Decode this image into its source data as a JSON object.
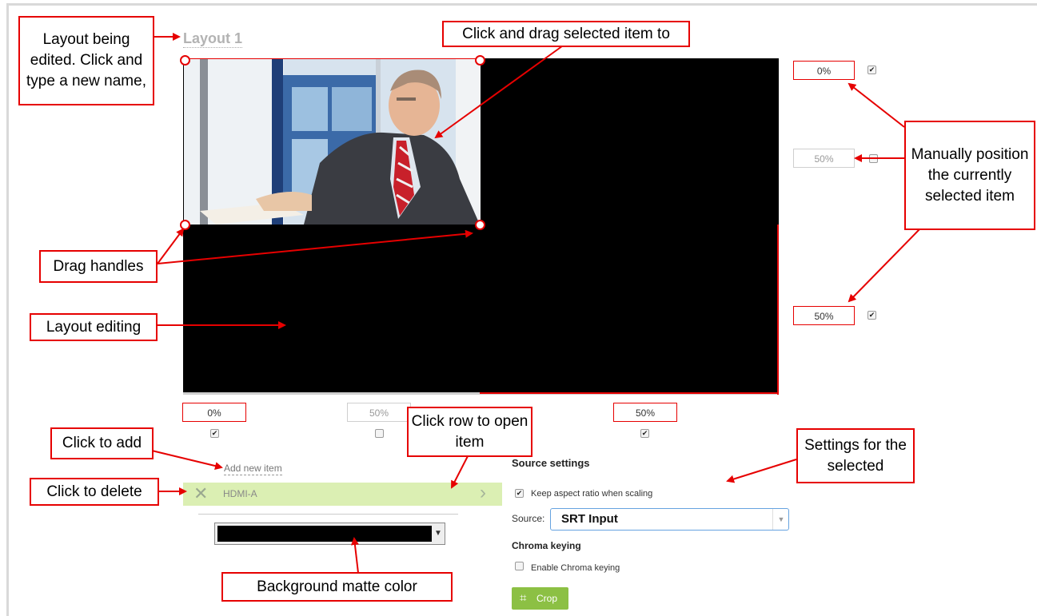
{
  "layout": {
    "title": "Layout 1"
  },
  "position_fields": {
    "top": "0%",
    "middle": "50%",
    "right_bottom": "50%",
    "bottom_left": "0%",
    "bottom_middle": "50%",
    "bottom_right": "50%"
  },
  "checkboxes": {
    "top": true,
    "middle": false,
    "right_bottom": true,
    "bottom_left": true,
    "bottom_middle": false,
    "bottom_right": true
  },
  "items": {
    "add_new_label": "Add new item",
    "rows": [
      {
        "label": "HDMI-A"
      }
    ]
  },
  "source_settings": {
    "heading": "Source settings",
    "keep_aspect_label": "Keep aspect ratio when scaling",
    "keep_aspect_checked": true,
    "source_label": "Source:",
    "source_value": "SRT Input",
    "chroma_heading": "Chroma keying",
    "chroma_label": "Enable Chroma keying",
    "chroma_checked": false,
    "crop_label": "Crop"
  },
  "background_matte": {
    "color": "#000000"
  },
  "annotations": {
    "layout_being_edited": "Layout being edited. Click and type a new name,",
    "click_and_drag": "Click and drag selected item to",
    "manually_position": "Manually position the currently selected item",
    "drag_handles": "Drag handles",
    "layout_editing": "Layout editing",
    "click_to_add": "Click to add",
    "click_to_delete": "Click to delete",
    "click_row": "Click row to open item",
    "settings_for_selected": "Settings for the selected",
    "background_matte_color": "Background matte color"
  },
  "colors": {
    "annotation_red": "#e60000",
    "item_row_green": "#dbefb3",
    "crop_green": "#8cc044"
  },
  "icons": {
    "delete": "close-icon",
    "open": "chevron-right-icon",
    "crop": "crop-icon",
    "dropdown": "caret-down-icon"
  }
}
